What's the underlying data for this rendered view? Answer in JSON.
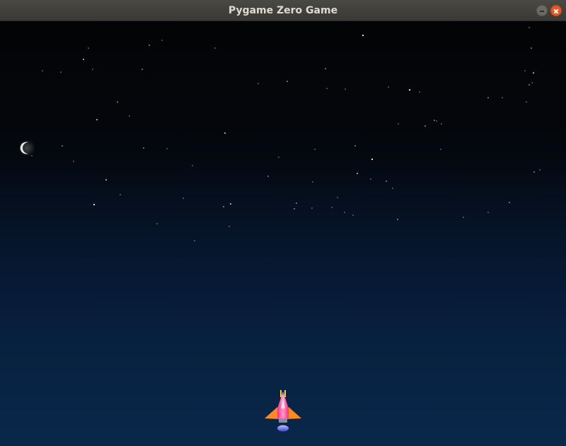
{
  "window": {
    "title": "Pygame Zero Game",
    "buttons": [
      {
        "name": "minimize",
        "icon": "minimize-icon"
      },
      {
        "name": "close",
        "icon": "close-icon"
      }
    ]
  },
  "game": {
    "sky_colors": {
      "top": "#030405",
      "bottom": "#09284a"
    },
    "sprites": [
      {
        "name": "player-spaceship",
        "colors": {
          "body": "#ff2f8f",
          "wings": "#ff8a1e",
          "engine": "#5a64d8"
        }
      },
      {
        "name": "crescent-moon"
      },
      {
        "name": "stars"
      }
    ]
  }
}
